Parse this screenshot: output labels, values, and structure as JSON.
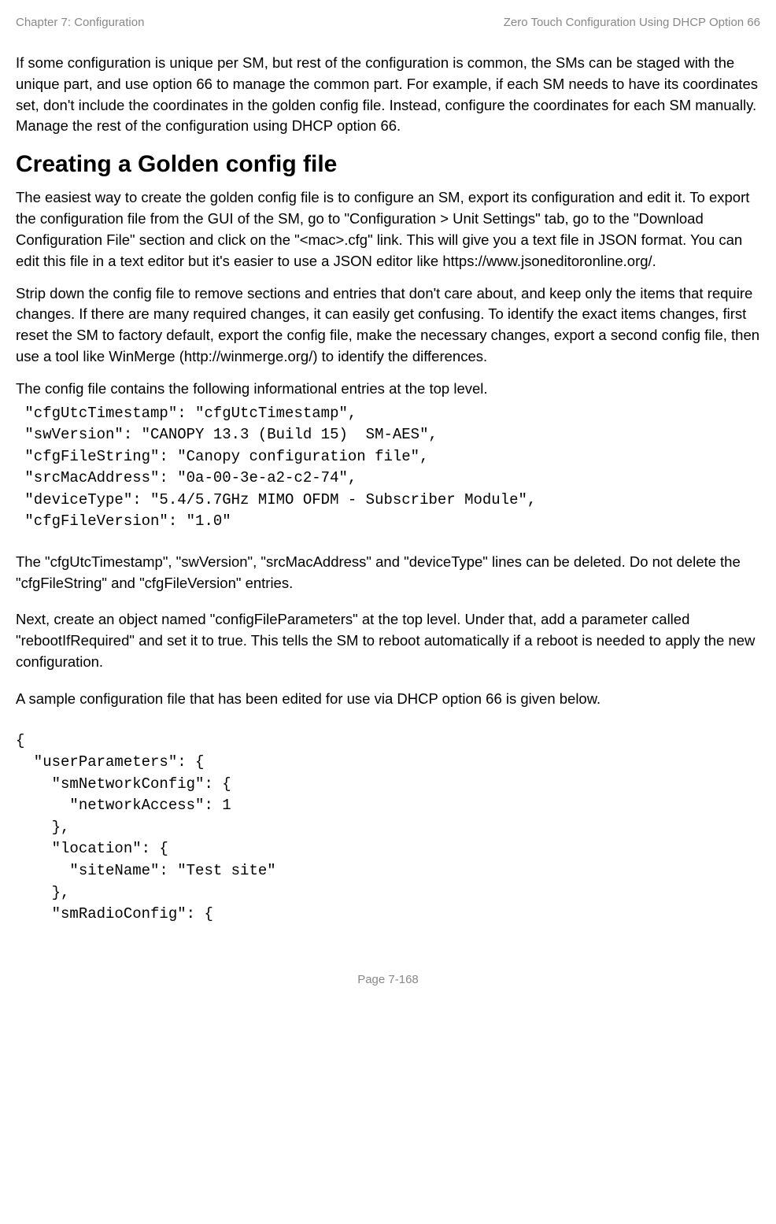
{
  "header": {
    "left": "Chapter 7:  Configuration",
    "right": "Zero Touch Configuration Using DHCP Option 66"
  },
  "intro": "If some configuration is unique per SM, but rest of the configuration is common, the SMs can be staged with the unique part, and use option 66 to manage the common part. For example, if each SM needs to have its coordinates set, don't include the coordinates in the golden config file. Instead, configure the coordinates for each SM manually. Manage the rest of the configuration using DHCP option 66.",
  "heading": "Creating a Golden config file",
  "p1": "The easiest way to create the golden config file is to configure an SM, export its configuration and edit it. To export the configuration file from the GUI of the SM, go to \"Configuration > Unit Settings\" tab, go to the \"Download Configuration File\" section and click on the \"<mac>.cfg\" link. This will give you a text file in JSON format. You can edit this file in a text editor but it's easier to use a JSON editor like https://www.jsoneditoronline.org/.",
  "p2": "Strip down the config file to remove sections and entries that don't care about, and keep only the items that require changes. If there are many required changes, it can easily get confusing. To identify the exact items changes, first reset the SM to factory default, export the config file, make the necessary changes, export a second config file, then use a tool like WinMerge (http://winmerge.org/) to identify the differences.",
  "p3": "The config file contains the following informational entries at the top level.",
  "code1": " \"cfgUtcTimestamp\": \"cfgUtcTimestamp\",\n \"swVersion\": \"CANOPY 13.3 (Build 15)  SM-AES\",\n \"cfgFileString\": \"Canopy configuration file\",\n \"srcMacAddress\": \"0a-00-3e-a2-c2-74\",\n \"deviceType\": \"5.4/5.7GHz MIMO OFDM - Subscriber Module\",\n \"cfgFileVersion\": \"1.0\"",
  "p4": "The \"cfgUtcTimestamp\", \"swVersion\", \"srcMacAddress\" and \"deviceType\" lines can be deleted. Do not delete the \"cfgFileString\" and \"cfgFileVersion\" entries.",
  "p5": "Next, create an object named \"configFileParameters\" at the top level. Under that, add a parameter called \"rebootIfRequired\" and set it to true.  This tells the SM to reboot automatically if a reboot is needed to apply the new configuration.",
  "p6": "A sample configuration file that has been edited for use via DHCP option 66 is given below.",
  "code2": "{\n  \"userParameters\": {\n    \"smNetworkConfig\": {\n      \"networkAccess\": 1\n    },\n    \"location\": {\n      \"siteName\": \"Test site\"\n    },\n    \"smRadioConfig\": {",
  "footer": "Page 7-168"
}
